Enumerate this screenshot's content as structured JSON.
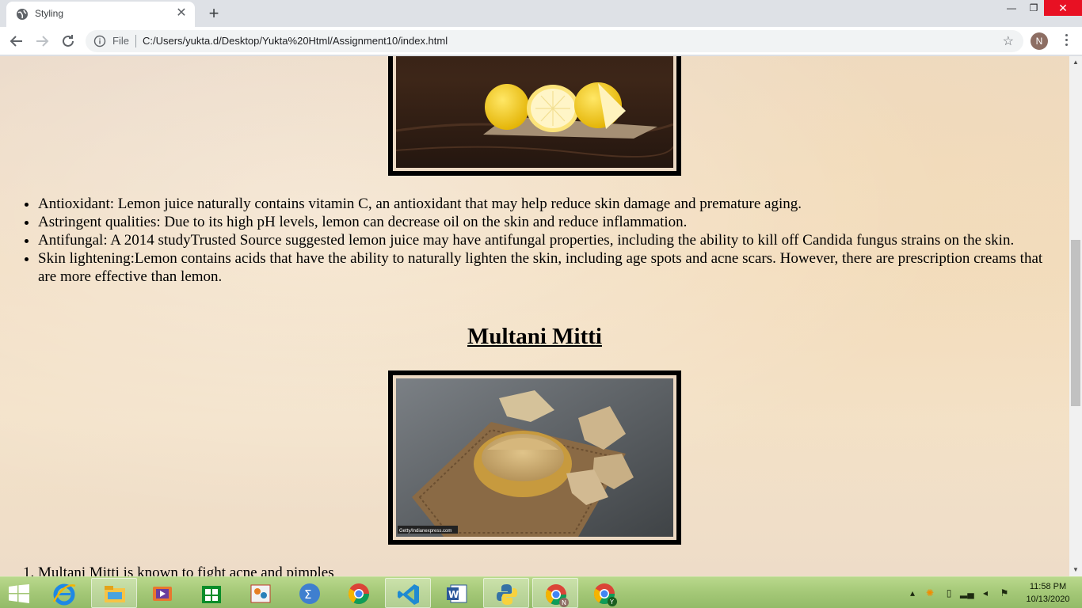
{
  "browser": {
    "tab": {
      "title": "Styling",
      "close_label": "✕"
    },
    "new_tab_label": "+",
    "window": {
      "minimize": "—",
      "maximize": "❐",
      "close": "✕"
    },
    "omnibox": {
      "scheme_label": "File",
      "url": "C:/Users/yukta.d/Desktop/Yukta%20Html/Assignment10/index.html"
    },
    "profile_initial": "N"
  },
  "page": {
    "benefits": [
      "Antioxidant: Lemon juice naturally contains vitamin C, an antioxidant that may help reduce skin damage and premature aging.",
      "Astringent qualities: Due to its high pH levels, lemon can decrease oil on the skin and reduce inflammation.",
      "Antifungal: A 2014 studyTrusted Source suggested lemon juice may have antifungal properties, including the ability to kill off Candida fungus strains on the skin.",
      "Skin lightening:Lemon contains acids that have the ability to naturally lighten the skin, including age spots and acne scars. However, there are prescription creams that are more effective than lemon."
    ],
    "section_heading": "Multani Mitti",
    "mitti_image_caption": "Getty/Indianexpress.com",
    "mitti_list": [
      "Multani Mitti is known to fight acne and pimples"
    ]
  },
  "taskbar": {
    "apps": [
      "start",
      "internet-explorer",
      "file-explorer",
      "media-player",
      "store",
      "paint",
      "calculator",
      "chrome",
      "vscode",
      "word",
      "python",
      "chrome-profile-n",
      "chrome-profile-y"
    ],
    "clock": {
      "time": "11:58 PM",
      "date": "10/13/2020"
    }
  },
  "colors": {
    "taskbar": "#a4c877",
    "close_button": "#e81123",
    "page_background": "#f1dcc0"
  }
}
